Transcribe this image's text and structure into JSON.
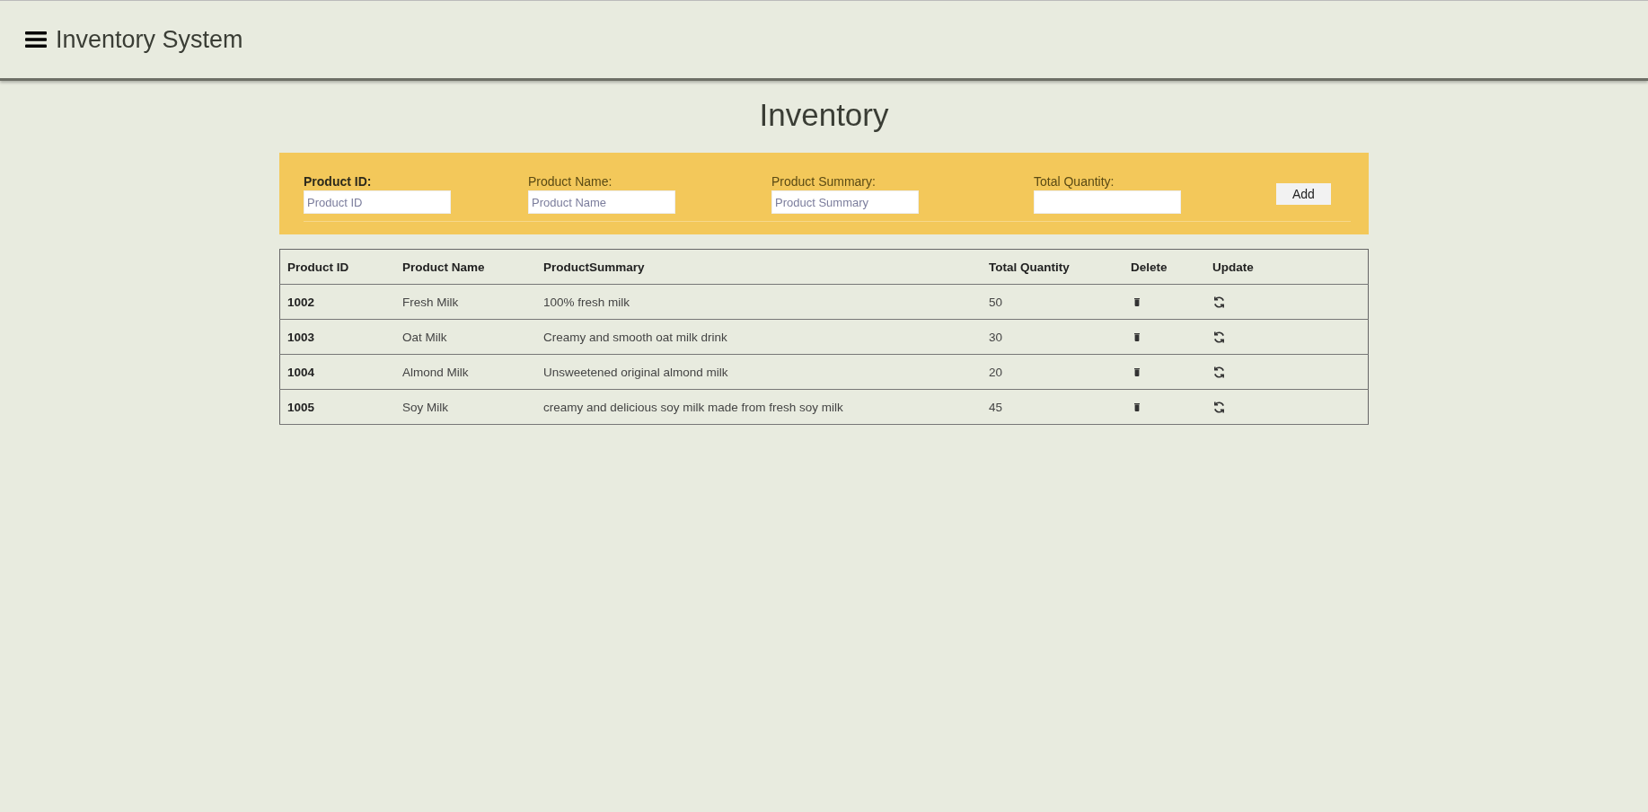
{
  "header": {
    "title": "Inventory System"
  },
  "page_title": "Inventory",
  "form": {
    "fields": [
      {
        "label": "Product ID:",
        "placeholder": "Product ID",
        "emphasized": true
      },
      {
        "label": "Product Name:",
        "placeholder": "Product Name",
        "emphasized": false
      },
      {
        "label": "Product Summary:",
        "placeholder": "Product Summary",
        "emphasized": false
      },
      {
        "label": "Total Quantity:",
        "emphasized": false
      }
    ],
    "button": "Add"
  },
  "table": {
    "columns": [
      "Product ID",
      "Product Name",
      "ProductSummary",
      "Total Quantity",
      "Delete",
      "Update"
    ],
    "rows": [
      {
        "id": "1002",
        "name": "Fresh Milk",
        "summary": "100% fresh milk",
        "quantity": "50"
      },
      {
        "id": "1003",
        "name": "Oat Milk",
        "summary": "Creamy and smooth oat milk drink",
        "quantity": "30"
      },
      {
        "id": "1004",
        "name": "Almond Milk",
        "summary": "Unsweetened original almond milk",
        "quantity": "20"
      },
      {
        "id": "1005",
        "name": "Soy Milk",
        "summary": "creamy and delicious soy milk made from fresh soy milk",
        "quantity": "45"
      }
    ]
  }
}
